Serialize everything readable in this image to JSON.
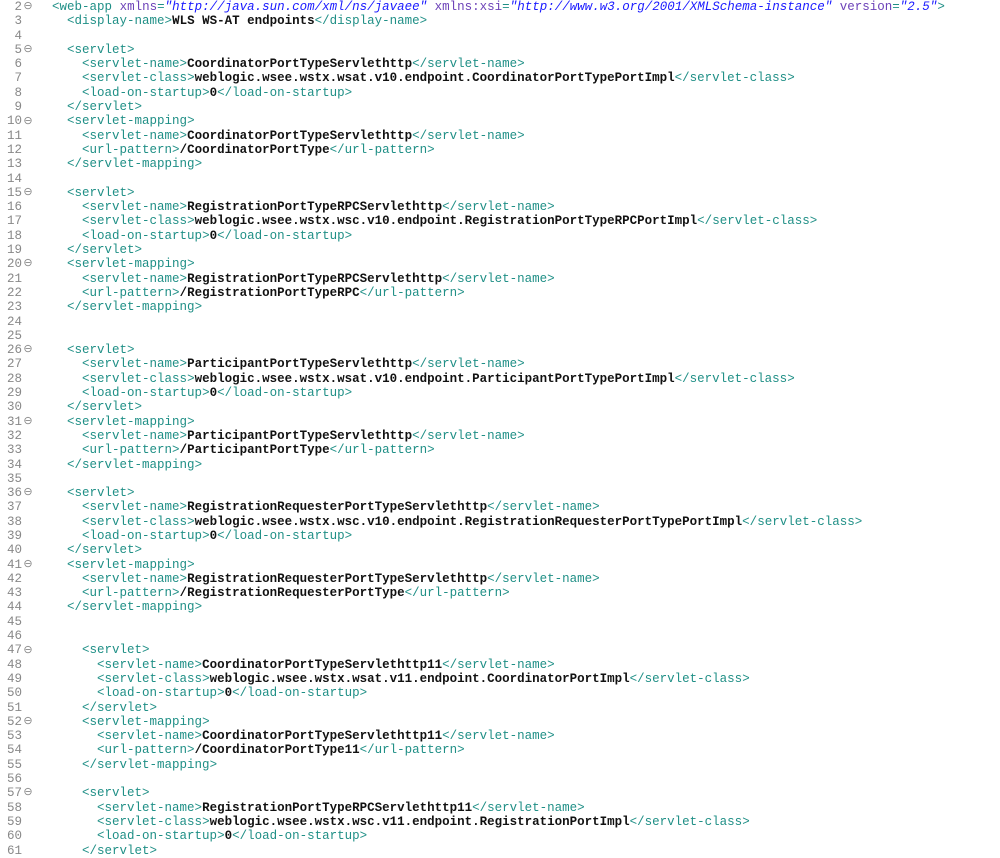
{
  "startLine": 2,
  "foldableLines": [
    2,
    5,
    10,
    15,
    20,
    26,
    31,
    36,
    41,
    47,
    52,
    57
  ],
  "lines": [
    {
      "i": 1,
      "tokens": [
        [
          "ang",
          "<"
        ],
        [
          "tag",
          "web-app"
        ],
        [
          "txt",
          " "
        ],
        [
          "attr",
          "xmlns"
        ],
        [
          "ang",
          "="
        ],
        [
          "aval",
          "\"http://java.sun.com/xml/ns/javaee\""
        ],
        [
          "txt",
          " "
        ],
        [
          "attr",
          "xmlns:xsi"
        ],
        [
          "ang",
          "="
        ],
        [
          "aval",
          "\"http://www.w3.org/2001/XMLSchema-instance\""
        ],
        [
          "txt",
          " "
        ],
        [
          "attr",
          "version"
        ],
        [
          "ang",
          "="
        ],
        [
          "aval",
          "\"2.5\""
        ],
        [
          "ang",
          ">"
        ]
      ]
    },
    {
      "i": 2,
      "tokens": [
        [
          "ang",
          "<"
        ],
        [
          "tag",
          "display-name"
        ],
        [
          "ang",
          ">"
        ],
        [
          "txt",
          "WLS WS-AT endpoints"
        ],
        [
          "ang",
          "</"
        ],
        [
          "tag",
          "display-name"
        ],
        [
          "ang",
          ">"
        ]
      ]
    },
    {
      "i": 0,
      "tokens": []
    },
    {
      "i": 2,
      "tokens": [
        [
          "ang",
          "<"
        ],
        [
          "tag",
          "servlet"
        ],
        [
          "ang",
          ">"
        ]
      ]
    },
    {
      "i": 3,
      "tokens": [
        [
          "ang",
          "<"
        ],
        [
          "tag",
          "servlet-name"
        ],
        [
          "ang",
          ">"
        ],
        [
          "txt",
          "CoordinatorPortTypeServlethttp"
        ],
        [
          "ang",
          "</"
        ],
        [
          "tag",
          "servlet-name"
        ],
        [
          "ang",
          ">"
        ]
      ]
    },
    {
      "i": 3,
      "tokens": [
        [
          "ang",
          "<"
        ],
        [
          "tag",
          "servlet-class"
        ],
        [
          "ang",
          ">"
        ],
        [
          "txt",
          "weblogic.wsee.wstx.wsat.v10.endpoint.CoordinatorPortTypePortImpl"
        ],
        [
          "ang",
          "</"
        ],
        [
          "tag",
          "servlet-class"
        ],
        [
          "ang",
          ">"
        ]
      ]
    },
    {
      "i": 3,
      "tokens": [
        [
          "ang",
          "<"
        ],
        [
          "tag",
          "load-on-startup"
        ],
        [
          "ang",
          ">"
        ],
        [
          "txt",
          "0"
        ],
        [
          "ang",
          "</"
        ],
        [
          "tag",
          "load-on-startup"
        ],
        [
          "ang",
          ">"
        ]
      ]
    },
    {
      "i": 2,
      "tokens": [
        [
          "ang",
          "</"
        ],
        [
          "tag",
          "servlet"
        ],
        [
          "ang",
          ">"
        ]
      ]
    },
    {
      "i": 2,
      "tokens": [
        [
          "ang",
          "<"
        ],
        [
          "tag",
          "servlet-mapping"
        ],
        [
          "ang",
          ">"
        ]
      ]
    },
    {
      "i": 3,
      "tokens": [
        [
          "ang",
          "<"
        ],
        [
          "tag",
          "servlet-name"
        ],
        [
          "ang",
          ">"
        ],
        [
          "txt",
          "CoordinatorPortTypeServlethttp"
        ],
        [
          "ang",
          "</"
        ],
        [
          "tag",
          "servlet-name"
        ],
        [
          "ang",
          ">"
        ]
      ]
    },
    {
      "i": 3,
      "tokens": [
        [
          "ang",
          "<"
        ],
        [
          "tag",
          "url-pattern"
        ],
        [
          "ang",
          ">"
        ],
        [
          "txt",
          "/CoordinatorPortType"
        ],
        [
          "ang",
          "</"
        ],
        [
          "tag",
          "url-pattern"
        ],
        [
          "ang",
          ">"
        ]
      ]
    },
    {
      "i": 2,
      "tokens": [
        [
          "ang",
          "</"
        ],
        [
          "tag",
          "servlet-mapping"
        ],
        [
          "ang",
          ">"
        ]
      ]
    },
    {
      "i": 0,
      "tokens": []
    },
    {
      "i": 2,
      "tokens": [
        [
          "ang",
          "<"
        ],
        [
          "tag",
          "servlet"
        ],
        [
          "ang",
          ">"
        ]
      ]
    },
    {
      "i": 3,
      "tokens": [
        [
          "ang",
          "<"
        ],
        [
          "tag",
          "servlet-name"
        ],
        [
          "ang",
          ">"
        ],
        [
          "txt",
          "RegistrationPortTypeRPCServlethttp"
        ],
        [
          "ang",
          "</"
        ],
        [
          "tag",
          "servlet-name"
        ],
        [
          "ang",
          ">"
        ]
      ]
    },
    {
      "i": 3,
      "tokens": [
        [
          "ang",
          "<"
        ],
        [
          "tag",
          "servlet-class"
        ],
        [
          "ang",
          ">"
        ],
        [
          "txt",
          "weblogic.wsee.wstx.wsc.v10.endpoint.RegistrationPortTypeRPCPortImpl"
        ],
        [
          "ang",
          "</"
        ],
        [
          "tag",
          "servlet-class"
        ],
        [
          "ang",
          ">"
        ]
      ]
    },
    {
      "i": 3,
      "tokens": [
        [
          "ang",
          "<"
        ],
        [
          "tag",
          "load-on-startup"
        ],
        [
          "ang",
          ">"
        ],
        [
          "txt",
          "0"
        ],
        [
          "ang",
          "</"
        ],
        [
          "tag",
          "load-on-startup"
        ],
        [
          "ang",
          ">"
        ]
      ]
    },
    {
      "i": 2,
      "tokens": [
        [
          "ang",
          "</"
        ],
        [
          "tag",
          "servlet"
        ],
        [
          "ang",
          ">"
        ]
      ]
    },
    {
      "i": 2,
      "tokens": [
        [
          "ang",
          "<"
        ],
        [
          "tag",
          "servlet-mapping"
        ],
        [
          "ang",
          ">"
        ]
      ]
    },
    {
      "i": 3,
      "tokens": [
        [
          "ang",
          "<"
        ],
        [
          "tag",
          "servlet-name"
        ],
        [
          "ang",
          ">"
        ],
        [
          "txt",
          "RegistrationPortTypeRPCServlethttp"
        ],
        [
          "ang",
          "</"
        ],
        [
          "tag",
          "servlet-name"
        ],
        [
          "ang",
          ">"
        ]
      ]
    },
    {
      "i": 3,
      "tokens": [
        [
          "ang",
          "<"
        ],
        [
          "tag",
          "url-pattern"
        ],
        [
          "ang",
          ">"
        ],
        [
          "txt",
          "/RegistrationPortTypeRPC"
        ],
        [
          "ang",
          "</"
        ],
        [
          "tag",
          "url-pattern"
        ],
        [
          "ang",
          ">"
        ]
      ]
    },
    {
      "i": 2,
      "tokens": [
        [
          "ang",
          "</"
        ],
        [
          "tag",
          "servlet-mapping"
        ],
        [
          "ang",
          ">"
        ]
      ]
    },
    {
      "i": 0,
      "tokens": []
    },
    {
      "i": 0,
      "tokens": []
    },
    {
      "i": 2,
      "tokens": [
        [
          "ang",
          "<"
        ],
        [
          "tag",
          "servlet"
        ],
        [
          "ang",
          ">"
        ]
      ]
    },
    {
      "i": 3,
      "tokens": [
        [
          "ang",
          "<"
        ],
        [
          "tag",
          "servlet-name"
        ],
        [
          "ang",
          ">"
        ],
        [
          "txt",
          "ParticipantPortTypeServlethttp"
        ],
        [
          "ang",
          "</"
        ],
        [
          "tag",
          "servlet-name"
        ],
        [
          "ang",
          ">"
        ]
      ]
    },
    {
      "i": 3,
      "tokens": [
        [
          "ang",
          "<"
        ],
        [
          "tag",
          "servlet-class"
        ],
        [
          "ang",
          ">"
        ],
        [
          "txt",
          "weblogic.wsee.wstx.wsat.v10.endpoint.ParticipantPortTypePortImpl"
        ],
        [
          "ang",
          "</"
        ],
        [
          "tag",
          "servlet-class"
        ],
        [
          "ang",
          ">"
        ]
      ]
    },
    {
      "i": 3,
      "tokens": [
        [
          "ang",
          "<"
        ],
        [
          "tag",
          "load-on-startup"
        ],
        [
          "ang",
          ">"
        ],
        [
          "txt",
          "0"
        ],
        [
          "ang",
          "</"
        ],
        [
          "tag",
          "load-on-startup"
        ],
        [
          "ang",
          ">"
        ]
      ]
    },
    {
      "i": 2,
      "tokens": [
        [
          "ang",
          "</"
        ],
        [
          "tag",
          "servlet"
        ],
        [
          "ang",
          ">"
        ]
      ]
    },
    {
      "i": 2,
      "tokens": [
        [
          "ang",
          "<"
        ],
        [
          "tag",
          "servlet-mapping"
        ],
        [
          "ang",
          ">"
        ]
      ]
    },
    {
      "i": 3,
      "tokens": [
        [
          "ang",
          "<"
        ],
        [
          "tag",
          "servlet-name"
        ],
        [
          "ang",
          ">"
        ],
        [
          "txt",
          "ParticipantPortTypeServlethttp"
        ],
        [
          "ang",
          "</"
        ],
        [
          "tag",
          "servlet-name"
        ],
        [
          "ang",
          ">"
        ]
      ]
    },
    {
      "i": 3,
      "tokens": [
        [
          "ang",
          "<"
        ],
        [
          "tag",
          "url-pattern"
        ],
        [
          "ang",
          ">"
        ],
        [
          "txt",
          "/ParticipantPortType"
        ],
        [
          "ang",
          "</"
        ],
        [
          "tag",
          "url-pattern"
        ],
        [
          "ang",
          ">"
        ]
      ]
    },
    {
      "i": 2,
      "tokens": [
        [
          "ang",
          "</"
        ],
        [
          "tag",
          "servlet-mapping"
        ],
        [
          "ang",
          ">"
        ]
      ]
    },
    {
      "i": 0,
      "tokens": []
    },
    {
      "i": 2,
      "tokens": [
        [
          "ang",
          "<"
        ],
        [
          "tag",
          "servlet"
        ],
        [
          "ang",
          ">"
        ]
      ]
    },
    {
      "i": 3,
      "tokens": [
        [
          "ang",
          "<"
        ],
        [
          "tag",
          "servlet-name"
        ],
        [
          "ang",
          ">"
        ],
        [
          "txt",
          "RegistrationRequesterPortTypeServlethttp"
        ],
        [
          "ang",
          "</"
        ],
        [
          "tag",
          "servlet-name"
        ],
        [
          "ang",
          ">"
        ]
      ]
    },
    {
      "i": 3,
      "tokens": [
        [
          "ang",
          "<"
        ],
        [
          "tag",
          "servlet-class"
        ],
        [
          "ang",
          ">"
        ],
        [
          "txt",
          "weblogic.wsee.wstx.wsc.v10.endpoint.RegistrationRequesterPortTypePortImpl"
        ],
        [
          "ang",
          "</"
        ],
        [
          "tag",
          "servlet-class"
        ],
        [
          "ang",
          ">"
        ]
      ]
    },
    {
      "i": 3,
      "tokens": [
        [
          "ang",
          "<"
        ],
        [
          "tag",
          "load-on-startup"
        ],
        [
          "ang",
          ">"
        ],
        [
          "txt",
          "0"
        ],
        [
          "ang",
          "</"
        ],
        [
          "tag",
          "load-on-startup"
        ],
        [
          "ang",
          ">"
        ]
      ]
    },
    {
      "i": 2,
      "tokens": [
        [
          "ang",
          "</"
        ],
        [
          "tag",
          "servlet"
        ],
        [
          "ang",
          ">"
        ]
      ]
    },
    {
      "i": 2,
      "tokens": [
        [
          "ang",
          "<"
        ],
        [
          "tag",
          "servlet-mapping"
        ],
        [
          "ang",
          ">"
        ]
      ]
    },
    {
      "i": 3,
      "tokens": [
        [
          "ang",
          "<"
        ],
        [
          "tag",
          "servlet-name"
        ],
        [
          "ang",
          ">"
        ],
        [
          "txt",
          "RegistrationRequesterPortTypeServlethttp"
        ],
        [
          "ang",
          "</"
        ],
        [
          "tag",
          "servlet-name"
        ],
        [
          "ang",
          ">"
        ]
      ]
    },
    {
      "i": 3,
      "tokens": [
        [
          "ang",
          "<"
        ],
        [
          "tag",
          "url-pattern"
        ],
        [
          "ang",
          ">"
        ],
        [
          "txt",
          "/RegistrationRequesterPortType"
        ],
        [
          "ang",
          "</"
        ],
        [
          "tag",
          "url-pattern"
        ],
        [
          "ang",
          ">"
        ]
      ]
    },
    {
      "i": 2,
      "tokens": [
        [
          "ang",
          "</"
        ],
        [
          "tag",
          "servlet-mapping"
        ],
        [
          "ang",
          ">"
        ]
      ]
    },
    {
      "i": 0,
      "tokens": []
    },
    {
      "i": 0,
      "tokens": []
    },
    {
      "i": 3,
      "tokens": [
        [
          "ang",
          "<"
        ],
        [
          "tag",
          "servlet"
        ],
        [
          "ang",
          ">"
        ]
      ]
    },
    {
      "i": 4,
      "tokens": [
        [
          "ang",
          "<"
        ],
        [
          "tag",
          "servlet-name"
        ],
        [
          "ang",
          ">"
        ],
        [
          "txt",
          "CoordinatorPortTypeServlethttp11"
        ],
        [
          "ang",
          "</"
        ],
        [
          "tag",
          "servlet-name"
        ],
        [
          "ang",
          ">"
        ]
      ]
    },
    {
      "i": 4,
      "tokens": [
        [
          "ang",
          "<"
        ],
        [
          "tag",
          "servlet-class"
        ],
        [
          "ang",
          ">"
        ],
        [
          "txt",
          "weblogic.wsee.wstx.wsat.v11.endpoint.CoordinatorPortImpl"
        ],
        [
          "ang",
          "</"
        ],
        [
          "tag",
          "servlet-class"
        ],
        [
          "ang",
          ">"
        ]
      ]
    },
    {
      "i": 4,
      "tokens": [
        [
          "ang",
          "<"
        ],
        [
          "tag",
          "load-on-startup"
        ],
        [
          "ang",
          ">"
        ],
        [
          "txt",
          "0"
        ],
        [
          "ang",
          "</"
        ],
        [
          "tag",
          "load-on-startup"
        ],
        [
          "ang",
          ">"
        ]
      ]
    },
    {
      "i": 3,
      "tokens": [
        [
          "ang",
          "</"
        ],
        [
          "tag",
          "servlet"
        ],
        [
          "ang",
          ">"
        ]
      ]
    },
    {
      "i": 3,
      "tokens": [
        [
          "ang",
          "<"
        ],
        [
          "tag",
          "servlet-mapping"
        ],
        [
          "ang",
          ">"
        ]
      ]
    },
    {
      "i": 4,
      "tokens": [
        [
          "ang",
          "<"
        ],
        [
          "tag",
          "servlet-name"
        ],
        [
          "ang",
          ">"
        ],
        [
          "txt",
          "CoordinatorPortTypeServlethttp11"
        ],
        [
          "ang",
          "</"
        ],
        [
          "tag",
          "servlet-name"
        ],
        [
          "ang",
          ">"
        ]
      ]
    },
    {
      "i": 4,
      "tokens": [
        [
          "ang",
          "<"
        ],
        [
          "tag",
          "url-pattern"
        ],
        [
          "ang",
          ">"
        ],
        [
          "txt",
          "/CoordinatorPortType11"
        ],
        [
          "ang",
          "</"
        ],
        [
          "tag",
          "url-pattern"
        ],
        [
          "ang",
          ">"
        ]
      ]
    },
    {
      "i": 3,
      "tokens": [
        [
          "ang",
          "</"
        ],
        [
          "tag",
          "servlet-mapping"
        ],
        [
          "ang",
          ">"
        ]
      ]
    },
    {
      "i": 0,
      "tokens": []
    },
    {
      "i": 3,
      "tokens": [
        [
          "ang",
          "<"
        ],
        [
          "tag",
          "servlet"
        ],
        [
          "ang",
          ">"
        ]
      ]
    },
    {
      "i": 4,
      "tokens": [
        [
          "ang",
          "<"
        ],
        [
          "tag",
          "servlet-name"
        ],
        [
          "ang",
          ">"
        ],
        [
          "txt",
          "RegistrationPortTypeRPCServlethttp11"
        ],
        [
          "ang",
          "</"
        ],
        [
          "tag",
          "servlet-name"
        ],
        [
          "ang",
          ">"
        ]
      ]
    },
    {
      "i": 4,
      "tokens": [
        [
          "ang",
          "<"
        ],
        [
          "tag",
          "servlet-class"
        ],
        [
          "ang",
          ">"
        ],
        [
          "txt",
          "weblogic.wsee.wstx.wsc.v11.endpoint.RegistrationPortImpl"
        ],
        [
          "ang",
          "</"
        ],
        [
          "tag",
          "servlet-class"
        ],
        [
          "ang",
          ">"
        ]
      ]
    },
    {
      "i": 4,
      "tokens": [
        [
          "ang",
          "<"
        ],
        [
          "tag",
          "load-on-startup"
        ],
        [
          "ang",
          ">"
        ],
        [
          "txt",
          "0"
        ],
        [
          "ang",
          "</"
        ],
        [
          "tag",
          "load-on-startup"
        ],
        [
          "ang",
          ">"
        ]
      ]
    },
    {
      "i": 3,
      "tokens": [
        [
          "ang",
          "</"
        ],
        [
          "tag",
          "servlet"
        ],
        [
          "ang",
          ">"
        ]
      ]
    }
  ]
}
